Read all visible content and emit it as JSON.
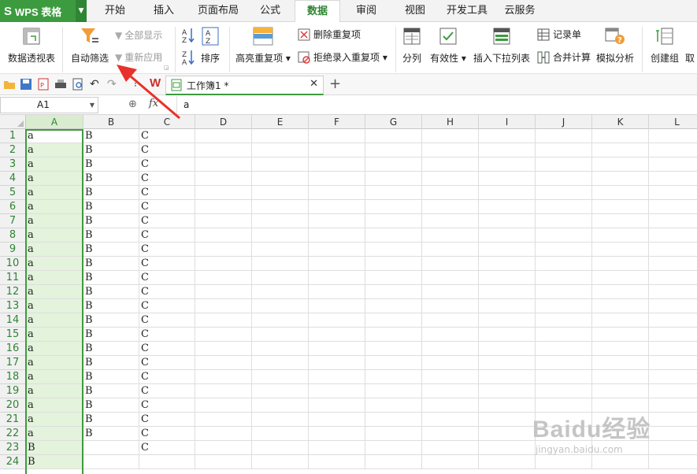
{
  "app": {
    "logo": "S",
    "title": "WPS 表格"
  },
  "menu_tabs": [
    {
      "label": "开始"
    },
    {
      "label": "插入"
    },
    {
      "label": "页面布局"
    },
    {
      "label": "公式"
    },
    {
      "label": "数据"
    },
    {
      "label": "审阅"
    },
    {
      "label": "视图"
    },
    {
      "label": "开发工具"
    },
    {
      "label": "云服务"
    }
  ],
  "active_tab": "数据",
  "ribbon": {
    "pivot": "数据透视表",
    "autofilter": "自动筛选",
    "show_all": "全部显示",
    "reapply": "重新应用",
    "sort": "排序",
    "highlight_dup": "高亮重复项",
    "remove_dup": "删除重复项",
    "reject_dup": "拒绝录入重复项",
    "split": "分列",
    "validity": "有效性",
    "insert_dropdown": "插入下拉列表",
    "record_form": "记录单",
    "consolidate": "合并计算",
    "what_if": "模拟分析",
    "create_group": "创建组",
    "cancel_group": "取"
  },
  "doc_tab": {
    "name": "工作簿1 *"
  },
  "formula_bar": {
    "name_box": "A1",
    "fx": "fx",
    "value": "a"
  },
  "columns": [
    "A",
    "B",
    "C",
    "D",
    "E",
    "F",
    "G",
    "H",
    "I",
    "J",
    "K",
    "L"
  ],
  "rows": [
    [
      "a",
      "B",
      "C"
    ],
    [
      "a",
      "B",
      "C"
    ],
    [
      "a",
      "B",
      "C"
    ],
    [
      "a",
      "B",
      "C"
    ],
    [
      "a",
      "B",
      "C"
    ],
    [
      "a",
      "B",
      "C"
    ],
    [
      "a",
      "B",
      "C"
    ],
    [
      "a",
      "B",
      "C"
    ],
    [
      "a",
      "B",
      "C"
    ],
    [
      "a",
      "B",
      "C"
    ],
    [
      "a",
      "B",
      "C"
    ],
    [
      "a",
      "B",
      "C"
    ],
    [
      "a",
      "B",
      "C"
    ],
    [
      "a",
      "B",
      "C"
    ],
    [
      "a",
      "B",
      "C"
    ],
    [
      "a",
      "B",
      "C"
    ],
    [
      "a",
      "B",
      "C"
    ],
    [
      "a",
      "B",
      "C"
    ],
    [
      "a",
      "B",
      "C"
    ],
    [
      "a",
      "B",
      "C"
    ],
    [
      "a",
      "B",
      "C"
    ],
    [
      "a",
      "B",
      "C"
    ],
    [
      "B",
      "",
      "C"
    ],
    [
      "B",
      "",
      ""
    ]
  ],
  "watermark": {
    "brand": "Baidu经验",
    "url": "jingyan.baidu.com"
  },
  "colors": {
    "accent": "#3d9b3f",
    "arrow": "#e8312a",
    "selection_fill": "#e4f3dc"
  }
}
